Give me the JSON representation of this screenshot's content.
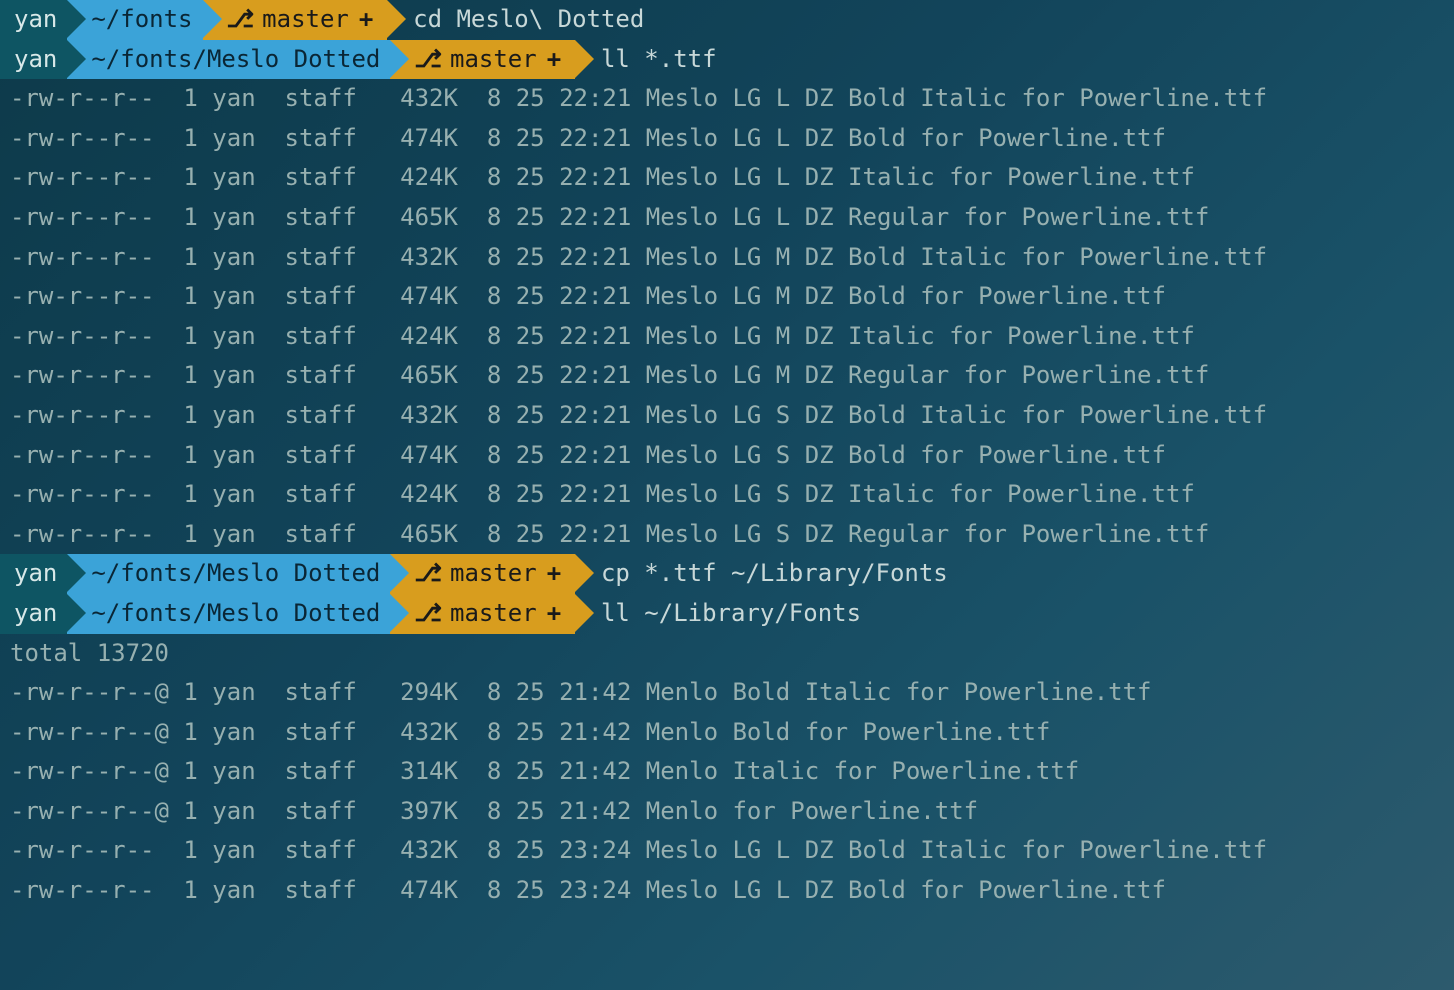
{
  "prompts": [
    {
      "user": "yan",
      "path": "~/fonts",
      "branch": "master",
      "plus": "+",
      "command": "cd Meslo\\ Dotted"
    },
    {
      "user": "yan",
      "path": "~/fonts/Meslo Dotted",
      "branch": "master",
      "plus": "+",
      "command": "ll *.ttf"
    },
    {
      "user": "yan",
      "path": "~/fonts/Meslo Dotted",
      "branch": "master",
      "plus": "+",
      "command": "cp *.ttf ~/Library/Fonts"
    },
    {
      "user": "yan",
      "path": "~/fonts/Meslo Dotted",
      "branch": "master",
      "plus": "+",
      "command": "ll ~/Library/Fonts"
    }
  ],
  "listing1": [
    "-rw-r--r--  1 yan  staff   432K  8 25 22:21 Meslo LG L DZ Bold Italic for Powerline.ttf",
    "-rw-r--r--  1 yan  staff   474K  8 25 22:21 Meslo LG L DZ Bold for Powerline.ttf",
    "-rw-r--r--  1 yan  staff   424K  8 25 22:21 Meslo LG L DZ Italic for Powerline.ttf",
    "-rw-r--r--  1 yan  staff   465K  8 25 22:21 Meslo LG L DZ Regular for Powerline.ttf",
    "-rw-r--r--  1 yan  staff   432K  8 25 22:21 Meslo LG M DZ Bold Italic for Powerline.ttf",
    "-rw-r--r--  1 yan  staff   474K  8 25 22:21 Meslo LG M DZ Bold for Powerline.ttf",
    "-rw-r--r--  1 yan  staff   424K  8 25 22:21 Meslo LG M DZ Italic for Powerline.ttf",
    "-rw-r--r--  1 yan  staff   465K  8 25 22:21 Meslo LG M DZ Regular for Powerline.ttf",
    "-rw-r--r--  1 yan  staff   432K  8 25 22:21 Meslo LG S DZ Bold Italic for Powerline.ttf",
    "-rw-r--r--  1 yan  staff   474K  8 25 22:21 Meslo LG S DZ Bold for Powerline.ttf",
    "-rw-r--r--  1 yan  staff   424K  8 25 22:21 Meslo LG S DZ Italic for Powerline.ttf",
    "-rw-r--r--  1 yan  staff   465K  8 25 22:21 Meslo LG S DZ Regular for Powerline.ttf"
  ],
  "total": "total 13720",
  "listing2": [
    "-rw-r--r--@ 1 yan  staff   294K  8 25 21:42 Menlo Bold Italic for Powerline.ttf",
    "-rw-r--r--@ 1 yan  staff   432K  8 25 21:42 Menlo Bold for Powerline.ttf",
    "-rw-r--r--@ 1 yan  staff   314K  8 25 21:42 Menlo Italic for Powerline.ttf",
    "-rw-r--r--@ 1 yan  staff   397K  8 25 21:42 Menlo for Powerline.ttf",
    "-rw-r--r--  1 yan  staff   432K  8 25 23:24 Meslo LG L DZ Bold Italic for Powerline.ttf",
    "-rw-r--r--  1 yan  staff   474K  8 25 23:24 Meslo LG L DZ Bold for Powerline.ttf"
  ],
  "icons": {
    "apple": "",
    "git": "⎇"
  }
}
